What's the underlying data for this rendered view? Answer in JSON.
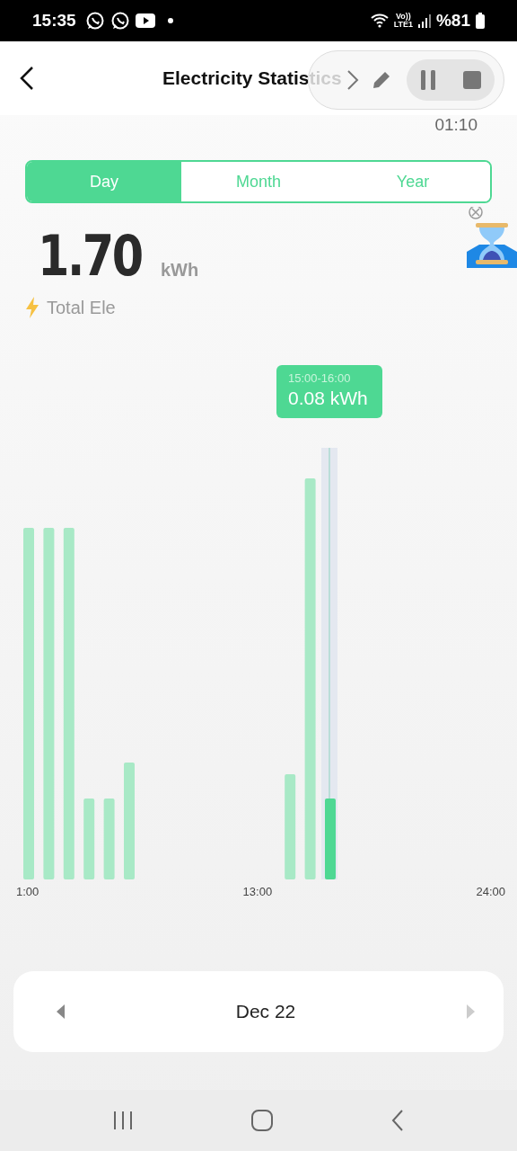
{
  "status_bar": {
    "time": "15:35",
    "volte": "Vo))",
    "lte": "LTE1",
    "battery": "%81"
  },
  "header": {
    "title": "Electricity Statistics"
  },
  "recorder": {
    "timer": "01:10"
  },
  "tabs": [
    {
      "label": "Day",
      "selected": true
    },
    {
      "label": "Month",
      "selected": false
    },
    {
      "label": "Year",
      "selected": false
    }
  ],
  "total": {
    "value": "1.70",
    "unit": "kWh",
    "label": "Total Ele"
  },
  "chart": {
    "tooltip": {
      "range": "15:00-16:00",
      "value": "0.08 kWh"
    },
    "x_labels": [
      "1:00",
      "13:00",
      "24:00"
    ]
  },
  "date_picker": {
    "label": "Dec 22"
  }
}
